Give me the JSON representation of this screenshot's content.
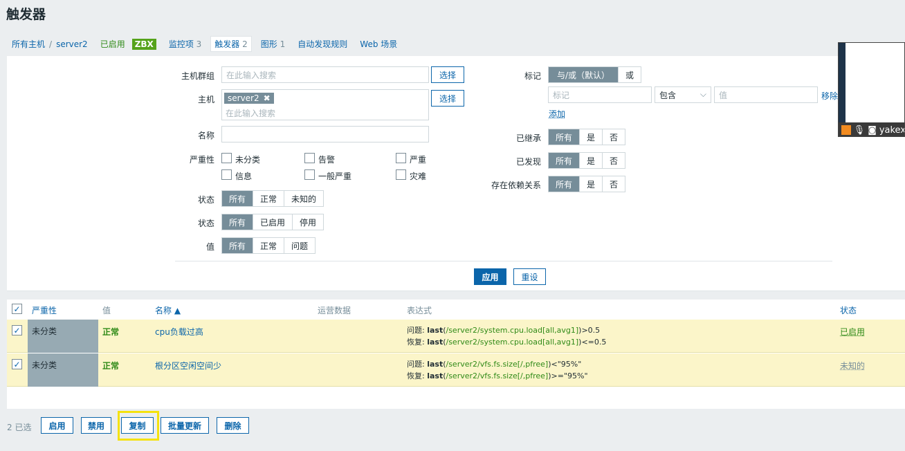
{
  "page": {
    "title": "触发器"
  },
  "breadcrumb": {
    "all_hosts": "所有主机",
    "sep": "/",
    "host": "server2",
    "enabled": "已启用",
    "zbx": "ZBX"
  },
  "tabs": [
    {
      "label": "监控项",
      "count": "3"
    },
    {
      "label": "触发器",
      "count": "2"
    },
    {
      "label": "图形",
      "count": "1"
    },
    {
      "label": "自动发现规则",
      "count": ""
    },
    {
      "label": "Web 场景",
      "count": ""
    }
  ],
  "filter": {
    "host_group_label": "主机群组",
    "host_group_placeholder": "在此输入搜索",
    "select_label": "选择",
    "host_label": "主机",
    "host_tag": "server2",
    "host_placeholder": "在此输入搜索",
    "name_label": "名称",
    "severity_label": "严重性",
    "severities": [
      "未分类",
      "告警",
      "严重",
      "信息",
      "一般严重",
      "灾难"
    ],
    "state_label": "状态",
    "state_options": [
      "所有",
      "正常",
      "未知的"
    ],
    "status_label": "状态",
    "status_options": [
      "所有",
      "已启用",
      "停用"
    ],
    "value_label": "值",
    "value_options": [
      "所有",
      "正常",
      "问题"
    ],
    "tags_label": "标记",
    "tags_options": [
      "与/或（默认）",
      "或"
    ],
    "tag_placeholder": "标记",
    "tag_op": "包含",
    "tag_value_placeholder": "值",
    "remove_label": "移除",
    "add_label": "添加",
    "inherited_label": "已继承",
    "discovered_label": "已发现",
    "depends_label": "存在依赖关系",
    "yn_options": [
      "所有",
      "是",
      "否"
    ],
    "apply": "应用",
    "reset": "重设"
  },
  "table": {
    "headers": {
      "severity": "严重性",
      "value": "值",
      "name": "名称 ▲",
      "ops": "运营数据",
      "expr": "表达式",
      "status": "状态"
    },
    "rows": [
      {
        "severity": "未分类",
        "value": "正常",
        "name": "cpu负载过高",
        "p_prefix": "问题: ",
        "p_fn": "last",
        "p_item": "/server2/system.cpu.load[all,avg1]",
        "p_rest": ">0.5",
        "r_prefix": "恢复: ",
        "r_fn": "last",
        "r_item": "/server2/system.cpu.load[all,avg1]",
        "r_rest": "<=0.5",
        "status": "已启用"
      },
      {
        "severity": "未分类",
        "value": "正常",
        "name": "根分区空闲空间少",
        "p_prefix": "问题: ",
        "p_fn": "last",
        "p_item": "/server2/vfs.fs.size[/,pfree]",
        "p_rest": "<\"95%\"",
        "r_prefix": "恢复: ",
        "r_fn": "last",
        "r_item": "/server2/vfs.fs.size[/,pfree]",
        "r_rest": ">=\"95%\"",
        "status": "未知的"
      }
    ]
  },
  "footer": {
    "selected": "2 已选",
    "enable": "启用",
    "disable": "禁用",
    "copy": "复制",
    "mass_update": "批量更新",
    "delete": "删除"
  },
  "overlay": {
    "name": "yakex"
  },
  "colors": {
    "accent": "#0b65aa",
    "green": "#2f8a17",
    "row_bg": "#fbf5c9",
    "highlight": "#f5e20e"
  }
}
